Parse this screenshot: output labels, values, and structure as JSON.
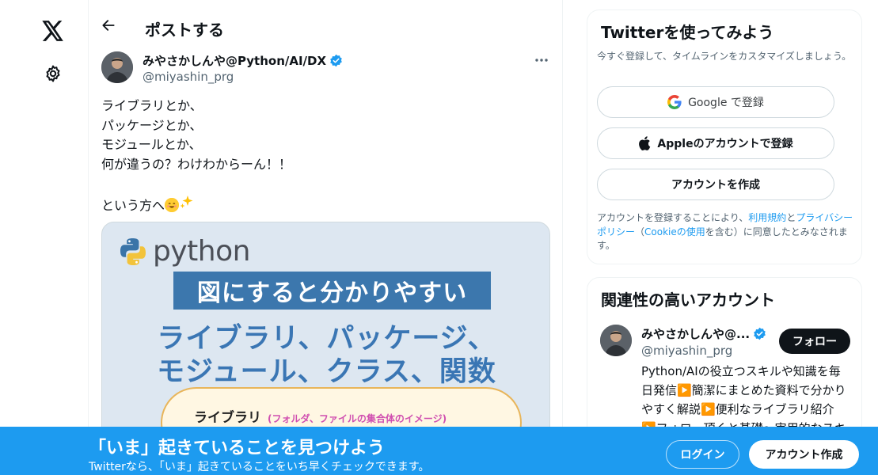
{
  "colors": {
    "accent": "#1d9bf0",
    "text": "#0f1419",
    "muted": "#536471",
    "follow_button_bg": "#0f1419",
    "banner_bg": "#3c77ad",
    "media_heading": "#3a76b4"
  },
  "nav": {
    "items": [
      {
        "icon": "x-logo-icon"
      },
      {
        "icon": "gear-icon"
      }
    ]
  },
  "header": {
    "back_icon": "arrow-left-icon",
    "title": "ポストする"
  },
  "tweet": {
    "author_name": "みやさかしんや@Python/AI/DX",
    "author_handle": "@miyashin_prg",
    "verified": true,
    "more_icon": "more-dots-icon",
    "lines": [
      "ライブラリとか、",
      "パッケージとか、",
      "モジュールとか、",
      "何が違うの？わけわからーん！！",
      "",
      "という方へ"
    ],
    "emoji": [
      "smiling-face-emoji",
      "sparkles-emoji"
    ],
    "media": {
      "logo_text": "python",
      "banner_text": "図にすると分かりやすい",
      "heading_line1": "ライブラリ、パッケージ、",
      "heading_line2": "モジュール、クラス、関数",
      "box_title": "ライブラリ",
      "box_subtitle": "(フォルダ、ファイルの集合体のイメージ)"
    }
  },
  "signup_card": {
    "title": "Twitterを使ってみよう",
    "subtitle": "今すぐ登録して、タイムラインをカスタマイズしましょう。",
    "google_label": "Google で登録",
    "apple_label": "Appleのアカウントで登録",
    "create_label": "アカウントを作成",
    "legal_prefix": "アカウントを登録することにより、",
    "terms_link": "利用規約",
    "legal_and": "と",
    "privacy_link": "プライバシーポリシー",
    "legal_paren_open": "（",
    "cookie_link": "Cookieの使用",
    "legal_suffix": "を含む）に同意したとみなされます。"
  },
  "related_card": {
    "title": "関連性の高いアカウント",
    "name": "みやさかしんや@...",
    "handle": "@miyashin_prg",
    "follow_label": "フォロー",
    "bio": "Python/AIの役立つスキルや知識を毎日発信▶️簡潔にまとめた資料で分かりやすく解説▶️便利なライブラリ紹介▶️フォロー頂くと基礎〜実用的なスキル"
  },
  "bottom_bar": {
    "title": "「いま」起きていることを見つけよう",
    "subtitle": "Twitterなら、「いま」起きていることをいち早くチェックできます。",
    "login_label": "ログイン",
    "signup_label": "アカウント作成"
  }
}
